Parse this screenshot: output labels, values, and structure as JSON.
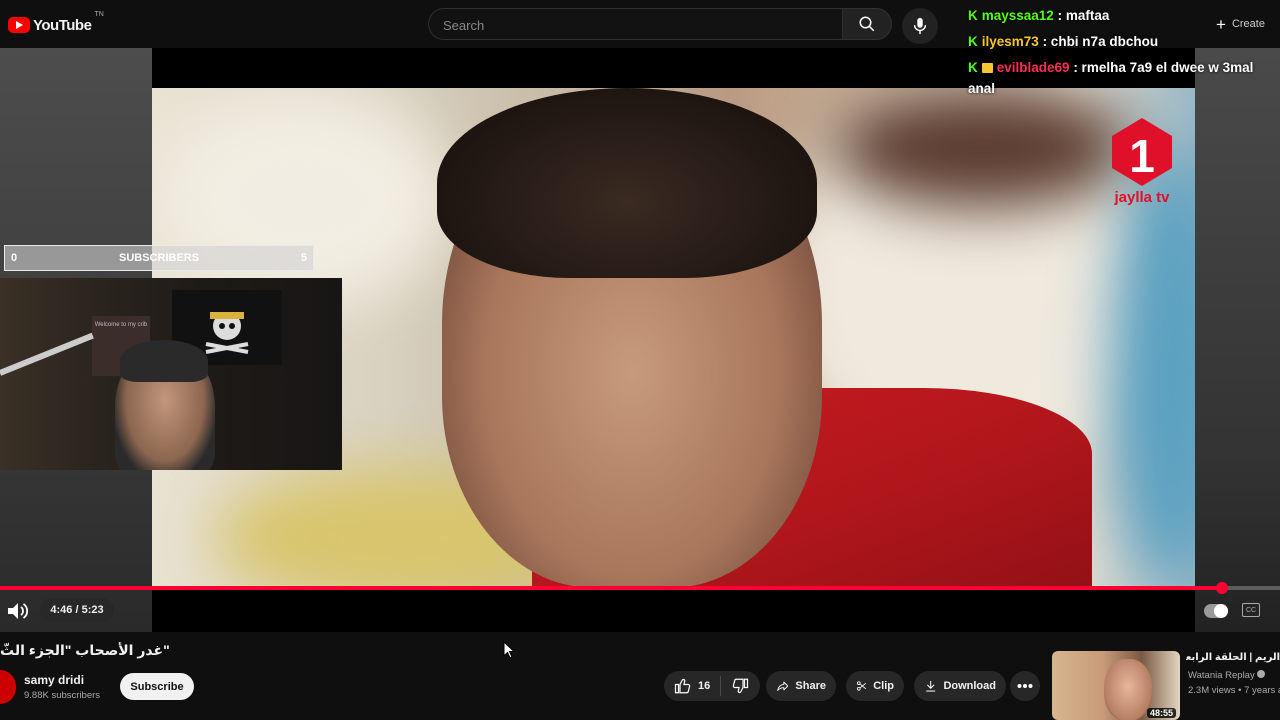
{
  "header": {
    "logo_text": "YouTube",
    "logo_sup": "TN",
    "search_placeholder": "Search",
    "create_label": "Create"
  },
  "chat": [
    {
      "user": "mayssaa12",
      "message": ": maftaa",
      "user_color": "#53fc18"
    },
    {
      "user": "ilyesm73",
      "message": ": chbi n7a dbchou",
      "user_color": "#f7c531"
    },
    {
      "user": "evilblade69",
      "message": ": rmelha 7a9 el dwee w 3mal",
      "message2": "anal",
      "user_color": "#ff2d55"
    }
  ],
  "overlay": {
    "subs_left": "0",
    "subs_label": "SUBSCRIBERS",
    "subs_right": "5",
    "channel_logo_text": "jaylla tv",
    "webcam_poster_text": "Welcome to my crib"
  },
  "player": {
    "time": "4:46 / 5:23",
    "progress": 0.955,
    "progress_color": "#ff0033"
  },
  "video": {
    "title": "\"غدر الأصحاب \"الجزء الثّ",
    "channel": "samy dridi",
    "subscribers": "9.88K subscribers",
    "subscribe_label": "Subscribe",
    "likes": "16",
    "share_label": "Share",
    "clip_label": "Clip",
    "download_label": "Download"
  },
  "related": {
    "title": "الريم | الحلقة الرابعة عشر",
    "channel": "Watania Replay",
    "views": "2.3M views • 7 years a",
    "duration": "48:55"
  }
}
